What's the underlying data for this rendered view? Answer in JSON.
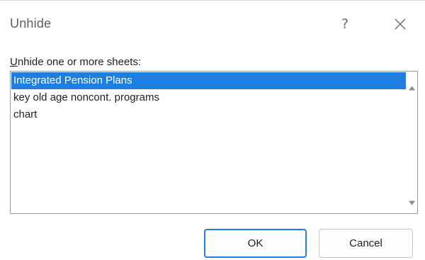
{
  "dialog": {
    "title": "Unhide",
    "help_label": "?",
    "prompt_mnemonic": "U",
    "prompt_rest": "nhide one or more sheets:"
  },
  "sheets": [
    {
      "label": "Integrated Pension Plans",
      "selected": true
    },
    {
      "label": "key old age noncont. programs",
      "selected": false
    },
    {
      "label": "chart",
      "selected": false
    }
  ],
  "buttons": {
    "ok_label": "OK",
    "cancel_label": "Cancel"
  },
  "colors": {
    "accent": "#1e7fe0",
    "selection_text": "#ffffff"
  },
  "icons": {
    "close": "close-icon",
    "scroll_up": "triangle-up-icon",
    "scroll_down": "triangle-down-icon"
  }
}
